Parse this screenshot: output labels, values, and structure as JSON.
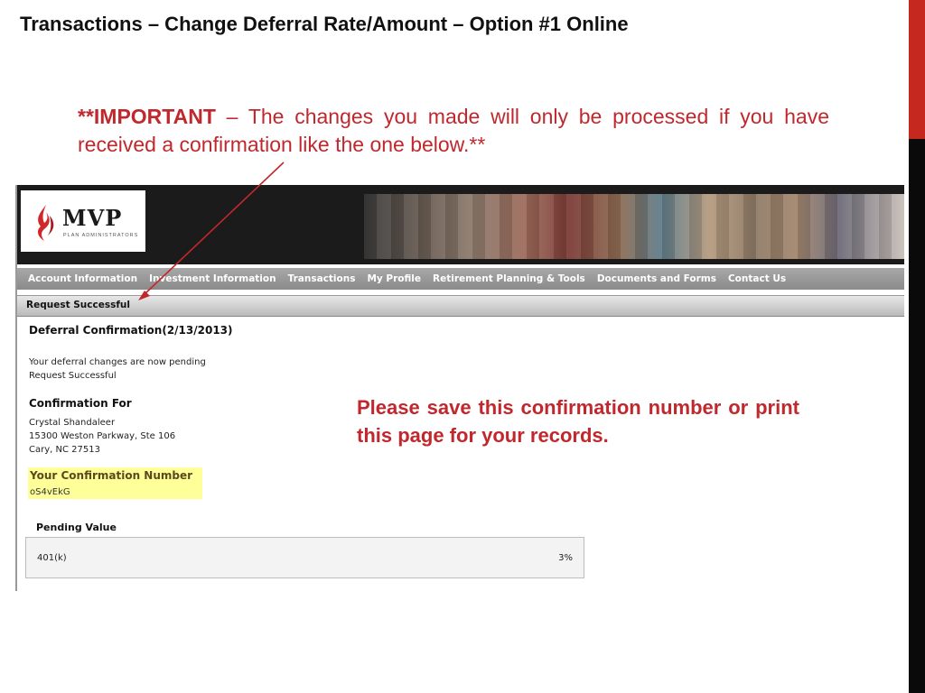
{
  "slide": {
    "title": "Transactions – Change Deferral Rate/Amount – Option #1 Online",
    "important_tag": "**IMPORTANT",
    "important_text": " – The changes you made will only be processed if you have received a confirmation like the one below.**",
    "note": "Please save this confirmation number or print this page for your records."
  },
  "screenshot": {
    "logo": {
      "name": "MVP",
      "subtitle": "PLAN ADMINISTRATORS",
      "icon": "flame-logo-icon"
    },
    "nav": [
      "Account Information",
      "Investment Information",
      "Transactions",
      "My Profile",
      "Retirement Planning & Tools",
      "Documents and Forms",
      "Contact Us"
    ],
    "status": "Request Successful",
    "deferral_title": "Deferral Confirmation(2/13/2013)",
    "pending_msg": "Your deferral changes are now pending",
    "request_msg": "Request Successful",
    "confirmation_for_label": "Confirmation For",
    "name": "Crystal Shandaleer",
    "address1": "15300 Weston Parkway, Ste 106",
    "address2": "Cary, NC 27513",
    "confirmation_number_label": "Your Confirmation Number",
    "confirmation_number": "oS4vEkG",
    "pending_value_label": "Pending Value",
    "pending_plan": "401(k)",
    "pending_rate": "3%"
  },
  "colors": {
    "accent_red": "#c0282d",
    "sidebar_red": "#c4281f",
    "highlight_yellow": "#ffff99"
  }
}
